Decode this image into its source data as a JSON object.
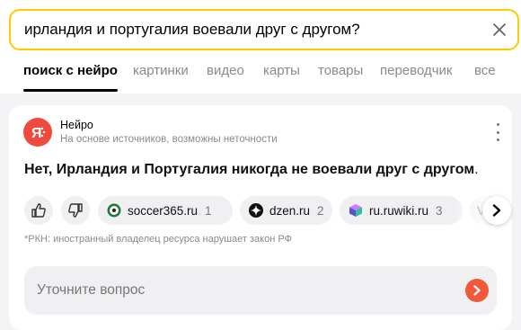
{
  "search": {
    "query": "ирландия и португалия воевали друг с другом?",
    "clear_icon": "close-icon"
  },
  "tabs": [
    {
      "label": "поиск с нейро",
      "active": true
    },
    {
      "label": "картинки",
      "active": false
    },
    {
      "label": "видео",
      "active": false
    },
    {
      "label": "карты",
      "active": false
    },
    {
      "label": "товары",
      "active": false
    },
    {
      "label": "переводчик",
      "active": false
    },
    {
      "label": "все",
      "active": false
    }
  ],
  "neuro": {
    "name": "Нейро",
    "subtitle": "На основе источников, возможны неточности",
    "logo_color": "#f04a3e",
    "answer": "Нет, Ирландия и Португалия никогда не воевали друг с другом",
    "answer_end": ".",
    "sources": [
      {
        "domain": "soccer365.ru",
        "num": "1",
        "icon": "soccer-ball-icon"
      },
      {
        "domain": "dzen.ru",
        "num": "2",
        "icon": "dzen-icon"
      },
      {
        "domain": "ru.ruwiki.ru",
        "num": "3",
        "icon": "ruwiki-icon"
      },
      {
        "domain": "V",
        "num": "",
        "icon": "wikipedia-icon"
      }
    ],
    "rkn_note": "*РКН: иностранный владелец ресурса нарушает закон РФ",
    "clarify_placeholder": "Уточните вопрос"
  },
  "colors": {
    "accent_yellow": "#ffcc00",
    "send_button": "#f05a3b"
  }
}
